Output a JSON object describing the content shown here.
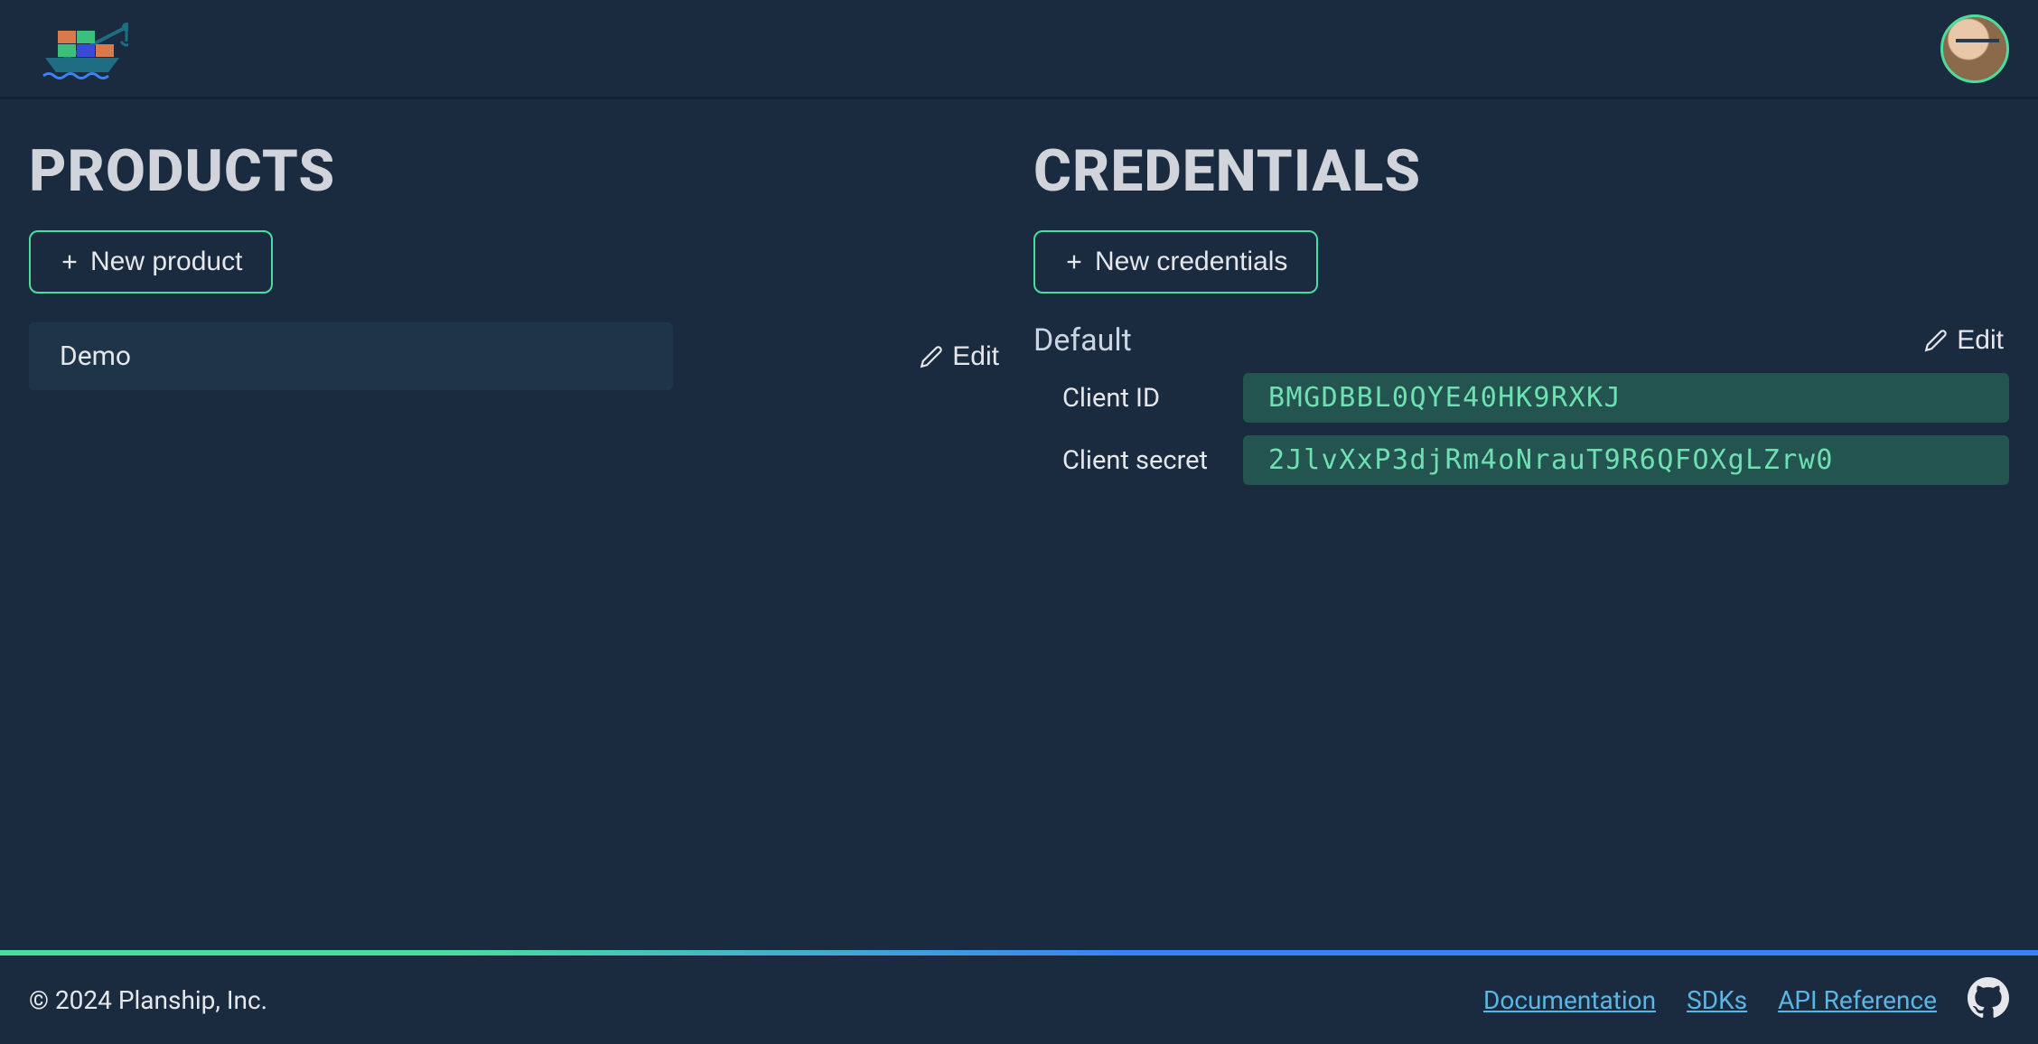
{
  "header": {
    "logo_alt": "Planship"
  },
  "products": {
    "title": "PRODUCTS",
    "new_button": "New product",
    "edit_label": "Edit",
    "items": [
      {
        "name": "Demo"
      }
    ]
  },
  "credentials": {
    "title": "CREDENTIALS",
    "new_button": "New credentials",
    "edit_label": "Edit",
    "items": [
      {
        "name": "Default",
        "client_id_label": "Client ID",
        "client_id": "BMGDBBL0QYE40HK9RXKJ",
        "client_secret_label": "Client secret",
        "client_secret": "2JlvXxP3djRm4oNrauT9R6QFOXgLZrw0"
      }
    ]
  },
  "footer": {
    "copyright": "© 2024 Planship, Inc.",
    "links": {
      "docs": "Documentation",
      "sdks": "SDKs",
      "api": "API Reference"
    }
  }
}
